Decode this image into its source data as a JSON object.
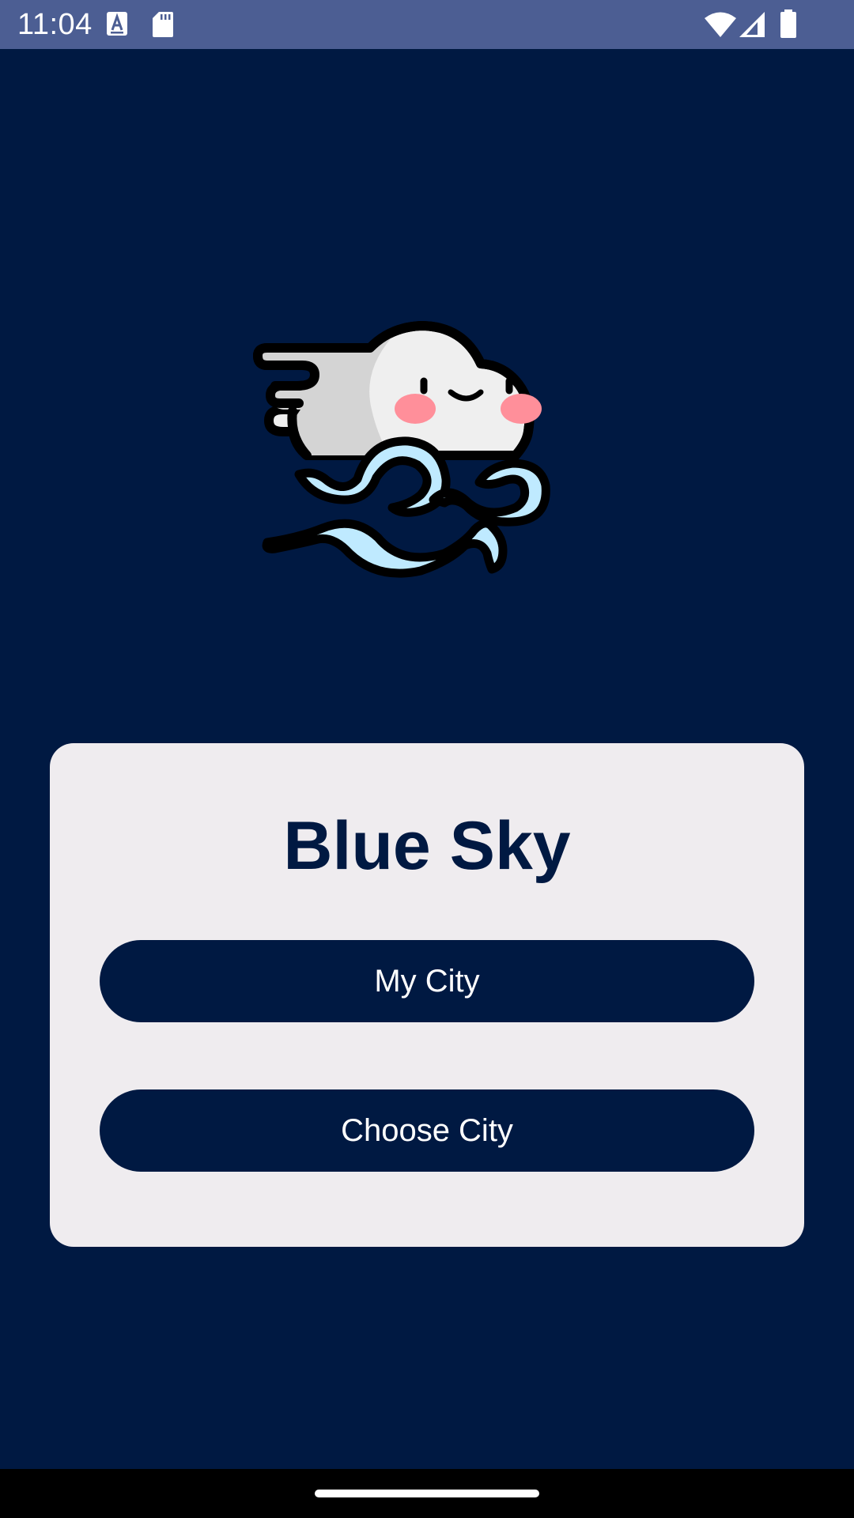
{
  "status_bar": {
    "time": "11:04"
  },
  "app": {
    "title": "Blue Sky",
    "buttons": {
      "my_city": "My City",
      "choose_city": "Choose City"
    }
  },
  "colors": {
    "background": "#001942",
    "status_bar": "#4c5e93",
    "card": "#efecef",
    "button": "#001942",
    "button_text": "#ffffff",
    "wind": "#bfeaff",
    "cheeks": "#ff8f9a"
  },
  "icons": {
    "status": [
      "text-a-icon",
      "sd-card-icon",
      "wifi-icon",
      "signal-icon",
      "battery-icon"
    ],
    "illustration": "cloud-wind-icon"
  }
}
